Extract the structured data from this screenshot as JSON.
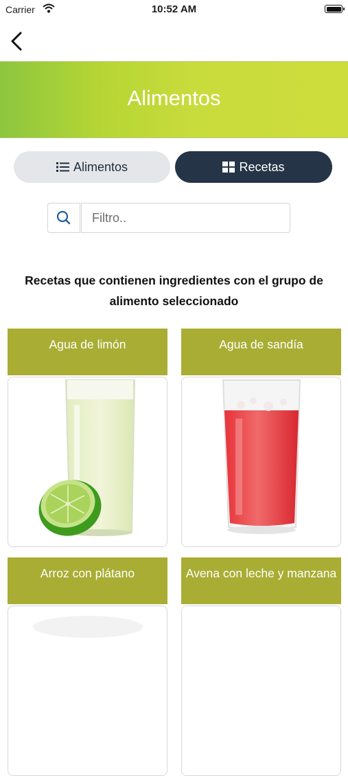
{
  "status_bar": {
    "carrier": "Carrier",
    "time": "10:52 AM"
  },
  "header": {
    "title": "Alimentos"
  },
  "segmented": {
    "alimentos_label": "Alimentos",
    "recetas_label": "Recetas",
    "selected": "Recetas"
  },
  "filter": {
    "placeholder": "Filtro..",
    "value": ""
  },
  "section": {
    "heading": "Recetas que contienen ingredientes con el grupo de alimento seleccionado"
  },
  "recipes": [
    {
      "title": "Agua de limón",
      "image": "lemon-water-image"
    },
    {
      "title": "Agua de sandía",
      "image": "watermelon-water-image"
    },
    {
      "title": "Arroz con plátano",
      "image": "rice-plantain-image"
    },
    {
      "title": "Avena con leche y manzana",
      "image": "oatmeal-apple-image"
    }
  ],
  "colors": {
    "banner_start": "#8cc63f",
    "banner_end": "#cddd3c",
    "card_title_bg": "#a9ad34",
    "segment_active": "#263447",
    "segment_inactive": "#e4e6ea",
    "search_icon": "#1f5f9e"
  }
}
